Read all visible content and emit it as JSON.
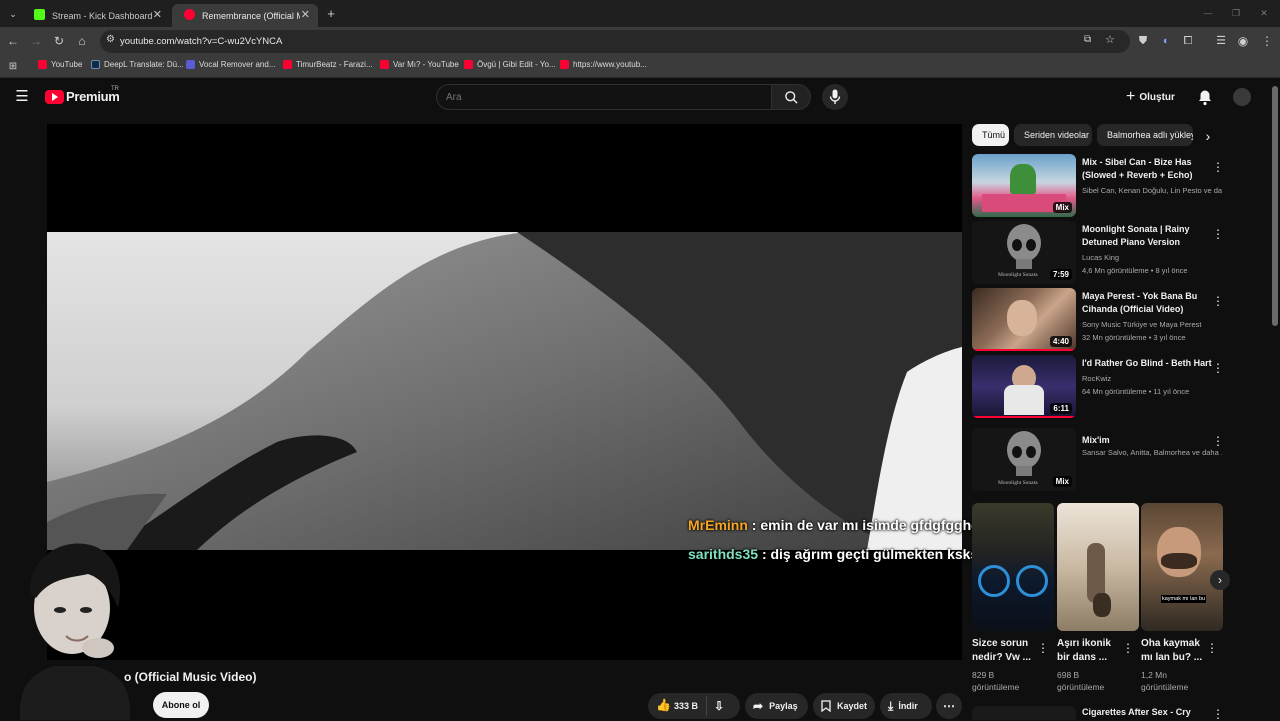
{
  "browser": {
    "tabs": [
      {
        "label": "Stream - Kick Dashboard",
        "favicon_color": "#53fc18"
      },
      {
        "label": "Remembrance (Official Music V",
        "favicon_color": "#ff0033"
      }
    ],
    "url": "youtube.com/watch?v=C-wu2VcYNCA",
    "bookmarks": [
      {
        "label": "YouTube",
        "color": "#ff0033"
      },
      {
        "label": "DeepL Translate: Dü...",
        "color": "#0f2b46"
      },
      {
        "label": "Vocal Remover and...",
        "color": "#5b5bd6"
      },
      {
        "label": "TimurBeatz - Farazi...",
        "color": "#ff0033"
      },
      {
        "label": "Var Mı? - YouTube",
        "color": "#ff0033"
      },
      {
        "label": "Övgü | Gibi Edit - Yo...",
        "color": "#ff0033"
      },
      {
        "label": "https://www.youtub...",
        "color": "#ff0033"
      }
    ]
  },
  "youtube": {
    "logo_text": "Premium",
    "logo_region": "TR",
    "search_placeholder": "Ara",
    "create_label": "Oluştur",
    "chips": [
      "Tümü",
      "Seriden videolar",
      "Balmorhea adlı yükleyiciden"
    ],
    "recommendations": [
      {
        "title": "Mix - Sibel Can - Bize Has (Slowed + Reverb + Echo)",
        "channel": "Sibel Can, Kenan Doğulu, Lin Pesto ve da...",
        "stats": "",
        "badge": "Mix"
      },
      {
        "title": "Moonlight Sonata | Rainy Detuned Piano Version",
        "channel": "Lucas King",
        "stats": "4,6 Mn görüntüleme • 8 yıl önce",
        "badge": "7:59"
      },
      {
        "title": "Maya Perest - Yok Bana Bu Cihanda (Official Video)",
        "channel": "Sony Music Türkiye ve Maya Perest",
        "stats": "32 Mn görüntüleme • 3 yıl önce",
        "badge": "4:40"
      },
      {
        "title": "I'd Rather Go Blind - Beth Hart",
        "channel": "RocKwiz",
        "stats": "64 Mn görüntüleme • 11 yıl önce",
        "badge": "6:11"
      },
      {
        "title": "Mix'im",
        "channel": "Sansar Salvo, Anitta, Balmorhea ve daha ...",
        "stats": "",
        "badge": "Mix"
      }
    ],
    "shorts": [
      {
        "title": "Sizce sorun nedir? Vw ...",
        "views": "829 B görüntüleme"
      },
      {
        "title": "Aşırı ikonik bir dans ...",
        "views": "698 B görüntüleme"
      },
      {
        "title": "Oha kaymak mı lan bu? ...",
        "views": "1,2 Mn görüntüleme"
      }
    ],
    "short_caption": "kaymak mı lan bu",
    "next_title": "Cigarettes After Sex - Cry",
    "video_title": "o (Official Music Video)",
    "subscribe_label": "Abone ol",
    "likes": "333 B",
    "share_label": "Paylaş",
    "save_label": "Kaydet",
    "download_label": "İndir",
    "thumb_caption": "Moonlight Sonata"
  },
  "chat": [
    {
      "user": "MrEminn",
      "message": ": emin de var mı isimde gfdgfgghgfhg",
      "user_color": "#f5a623"
    },
    {
      "user": "sarithds35",
      "message": ": diş ağrım geçti gülmekten ksksldpsspslpd",
      "user_color": "#7ee0c0"
    }
  ]
}
